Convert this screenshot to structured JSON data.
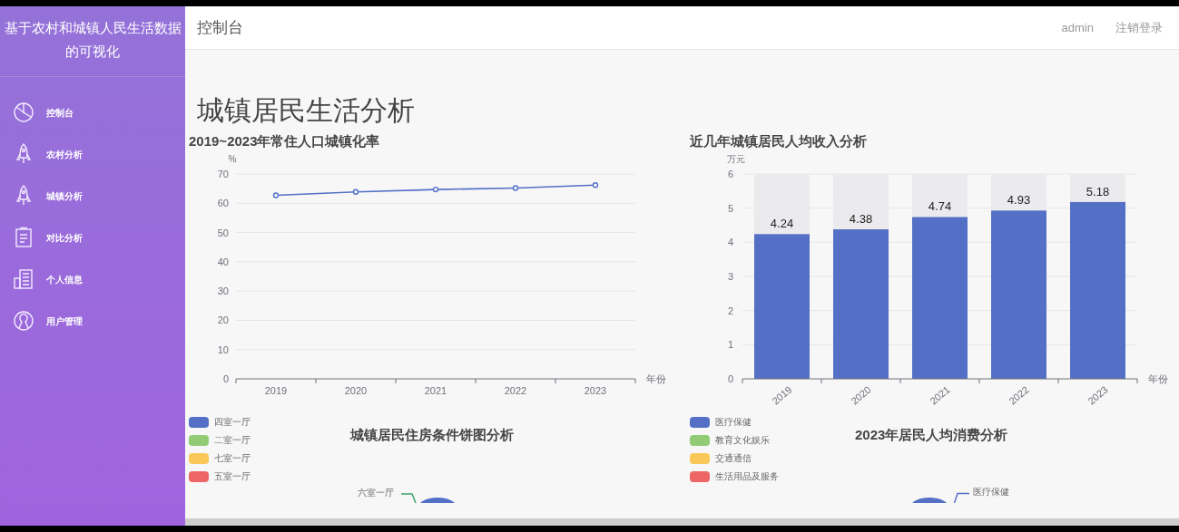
{
  "sidebar": {
    "title": "基于农村和城镇人民生活数据的可视化",
    "items": [
      {
        "label": "控制台",
        "kind": "pie",
        "selected": false
      },
      {
        "label": "农村分析",
        "kind": "rocket",
        "selected": false
      },
      {
        "label": "城镇分析",
        "kind": "rocket",
        "selected": false
      },
      {
        "label": "对比分析",
        "kind": "clipboard",
        "selected": false
      },
      {
        "label": "个人信息",
        "kind": "document",
        "selected": false
      },
      {
        "label": "用户管理",
        "kind": "user",
        "selected": false
      }
    ]
  },
  "header": {
    "title": "控制台",
    "user": "admin",
    "logout": "注销登录"
  },
  "page_title": "城镇居民生活分析",
  "line_panel": {
    "title": "2019~2023年常住人口城镇化率",
    "chart_data": {
      "type": "line",
      "ylabel": "%",
      "xlabel": "年份",
      "categories": [
        "2019",
        "2020",
        "2021",
        "2022",
        "2023"
      ],
      "series": [
        {
          "color": "#5470c6",
          "marker": "circle",
          "values": [
            62.7,
            63.9,
            64.7,
            65.2,
            66.2
          ]
        }
      ],
      "grid": true,
      "ylim": [
        0,
        70
      ],
      "yticks": [
        0,
        10,
        20,
        30,
        40,
        50,
        60,
        70
      ]
    }
  },
  "bar_panel": {
    "title": "近几年城镇居民人均收入分析",
    "chart_data": {
      "type": "bar",
      "ylabel": "万元",
      "xlabel": "年份",
      "categories": [
        "2019",
        "2020",
        "2021",
        "2022",
        "2023"
      ],
      "series": [
        {
          "color": "#5470c6",
          "values": [
            4.24,
            4.38,
            4.74,
            4.93,
            5.18
          ]
        },
        {
          "color": "#ebebee",
          "values": [
            1.76,
            1.62,
            1.26,
            1.07,
            0.82
          ]
        }
      ],
      "stacked": true,
      "grid": true,
      "ylim": [
        0,
        6
      ],
      "yticks": [
        0,
        1,
        2,
        3,
        4,
        5,
        6
      ],
      "value_labels": [
        [
          "4.24",
          "4.38",
          "4.74",
          "4.93",
          "5.18"
        ],
        [
          null,
          null,
          null,
          null,
          null
        ]
      ]
    }
  },
  "housing_panel": {
    "title": "城镇居民住房条件饼图分析",
    "legend": [
      {
        "label": "四室一厅",
        "color": "#5470c6"
      },
      {
        "label": "二室一厅",
        "color": "#91cc75"
      },
      {
        "label": "七室一厅",
        "color": "#fac858"
      },
      {
        "label": "五室一厅",
        "color": "#ee6666"
      }
    ],
    "slice_labels": [
      "六室一厅"
    ]
  },
  "spending_panel": {
    "title": "2023年居民人均消费分析",
    "legend": [
      {
        "label": "医疗保健",
        "color": "#5470c6"
      },
      {
        "label": "教育文化娱乐",
        "color": "#91cc75"
      },
      {
        "label": "交通通信",
        "color": "#fac858"
      },
      {
        "label": "生活用品及服务",
        "color": "#ee6666"
      }
    ],
    "slice_labels": [
      "医疗保健"
    ]
  }
}
